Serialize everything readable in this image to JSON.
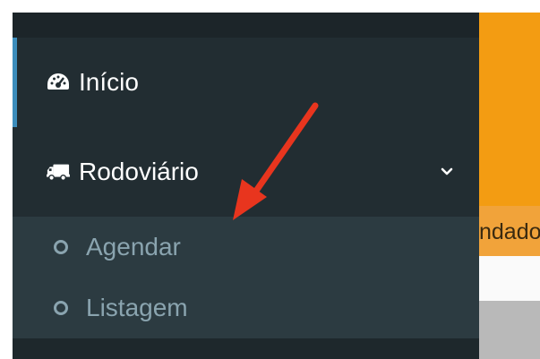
{
  "sidebar": {
    "items": [
      {
        "label": "Início",
        "icon": "tachometer-icon",
        "active": true
      },
      {
        "label": "Rodoviário",
        "icon": "truck-icon",
        "expanded": true,
        "chevron": "chevron-down-icon"
      }
    ],
    "submenu": [
      {
        "label": "Agendar",
        "icon": "circle-o-icon"
      },
      {
        "label": "Listagem",
        "icon": "circle-o-icon"
      }
    ]
  },
  "content": {
    "highlight_text": "ndado"
  },
  "annotation": {
    "icon": "red-arrow-icon",
    "color": "#e8351e"
  },
  "colors": {
    "sidebar_bg": "#222d32",
    "submenu_bg": "#2c3b41",
    "accent": "#3c8dbc",
    "header_orange": "#f39c12"
  }
}
